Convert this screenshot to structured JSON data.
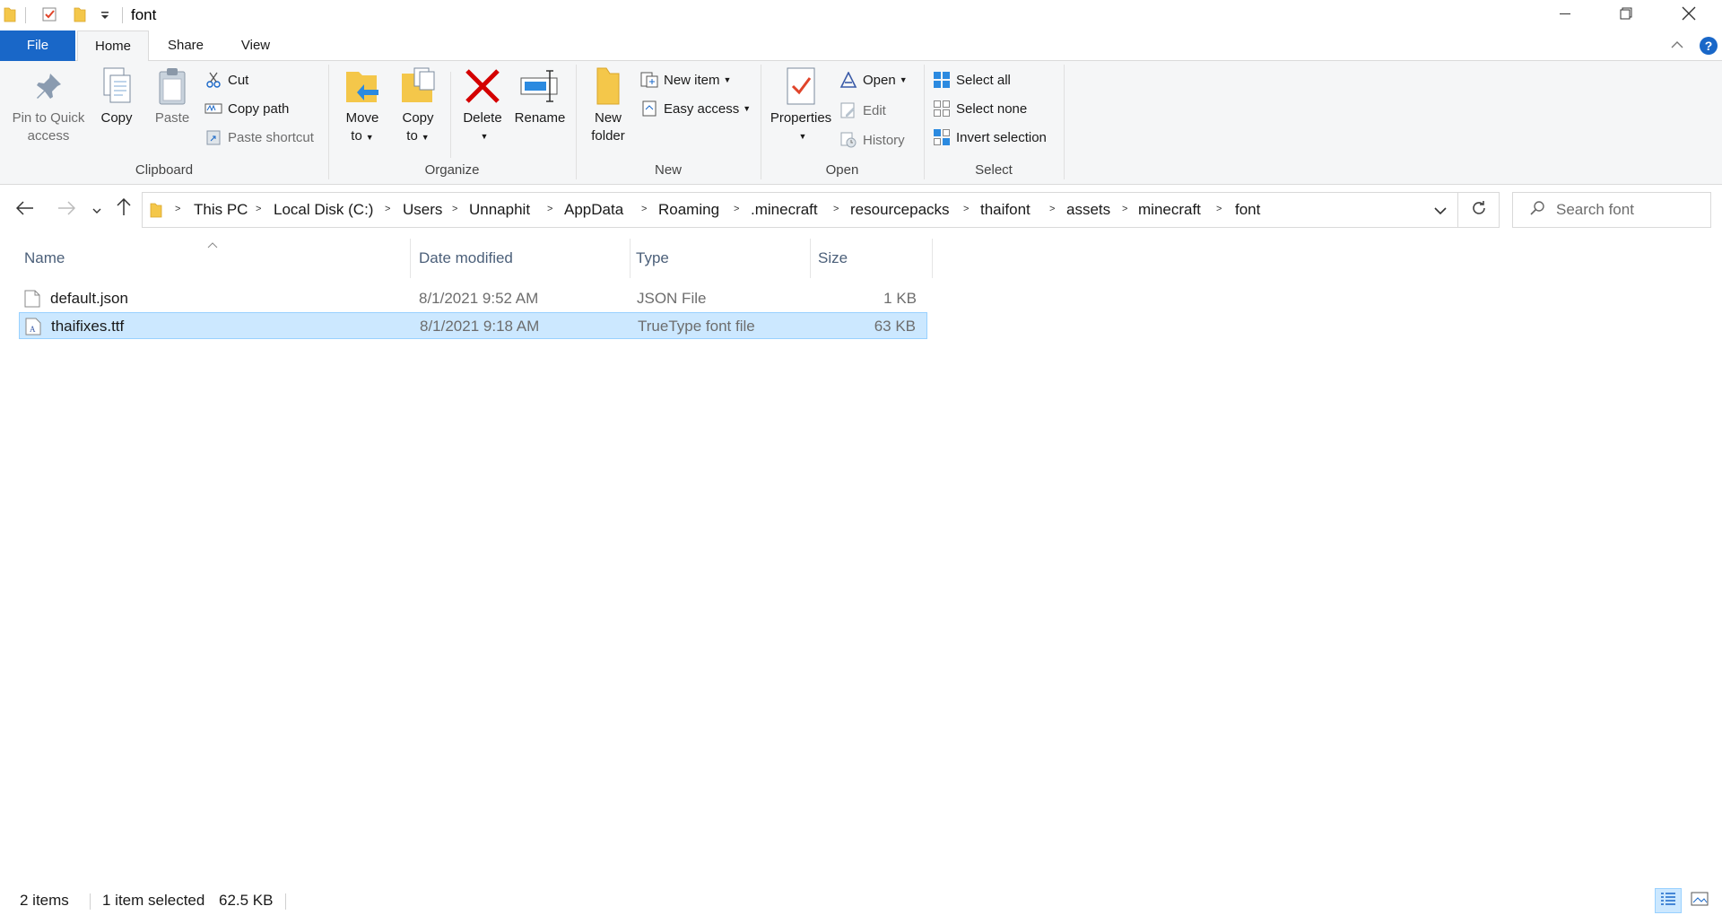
{
  "window": {
    "title": "font",
    "icons": [
      "folder-icon",
      "properties-check-icon",
      "new-folder-icon",
      "customize-qat-icon"
    ],
    "controls": [
      "minimize-icon",
      "restore-icon",
      "close-icon"
    ]
  },
  "ribbon_tabs": {
    "file": "File",
    "home": "Home",
    "share": "Share",
    "view": "View",
    "active": "Home"
  },
  "ribbon": {
    "clipboard": {
      "label": "Clipboard",
      "pin_line1": "Pin to Quick",
      "pin_line2": "access",
      "copy": "Copy",
      "paste": "Paste",
      "cut": "Cut",
      "copy_path": "Copy path",
      "paste_shortcut": "Paste shortcut"
    },
    "organize": {
      "label": "Organize",
      "move_line1": "Move",
      "move_line2": "to",
      "copy_line1": "Copy",
      "copy_line2": "to",
      "delete": "Delete",
      "rename": "Rename"
    },
    "new": {
      "label": "New",
      "new_folder_line1": "New",
      "new_folder_line2": "folder",
      "new_item": "New item",
      "easy_access": "Easy access"
    },
    "open": {
      "label": "Open",
      "properties": "Properties",
      "open": "Open",
      "edit": "Edit",
      "history": "History"
    },
    "select": {
      "label": "Select",
      "select_all": "Select all",
      "select_none": "Select none",
      "invert_selection": "Invert selection"
    }
  },
  "address": {
    "breadcrumbs": [
      "This PC",
      "Local Disk (C:)",
      "Users",
      "Unnaphit",
      "AppData",
      "Roaming",
      ".minecraft",
      "resourcepacks",
      "thaifont",
      "assets",
      "minecraft",
      "font"
    ],
    "search_placeholder": "Search font"
  },
  "columns": {
    "name": "Name",
    "date": "Date modified",
    "type": "Type",
    "size": "Size"
  },
  "files": [
    {
      "name": "default.json",
      "date": "8/1/2021 9:52 AM",
      "type": "JSON File",
      "size": "1 KB",
      "selected": false,
      "icon": "json-file-icon"
    },
    {
      "name": "thaifixes.ttf",
      "date": "8/1/2021 9:18 AM",
      "type": "TrueType font file",
      "size": "63 KB",
      "selected": true,
      "icon": "font-file-icon"
    }
  ],
  "status": {
    "item_count": "2 items",
    "selection": "1 item selected",
    "selection_size": "62.5 KB"
  },
  "colors": {
    "accent": "#1967c8",
    "selection_bg": "#cce8ff",
    "selection_border": "#99d1ff",
    "delete_red": "#d40000",
    "folder_yellow": "#f4c74a"
  }
}
